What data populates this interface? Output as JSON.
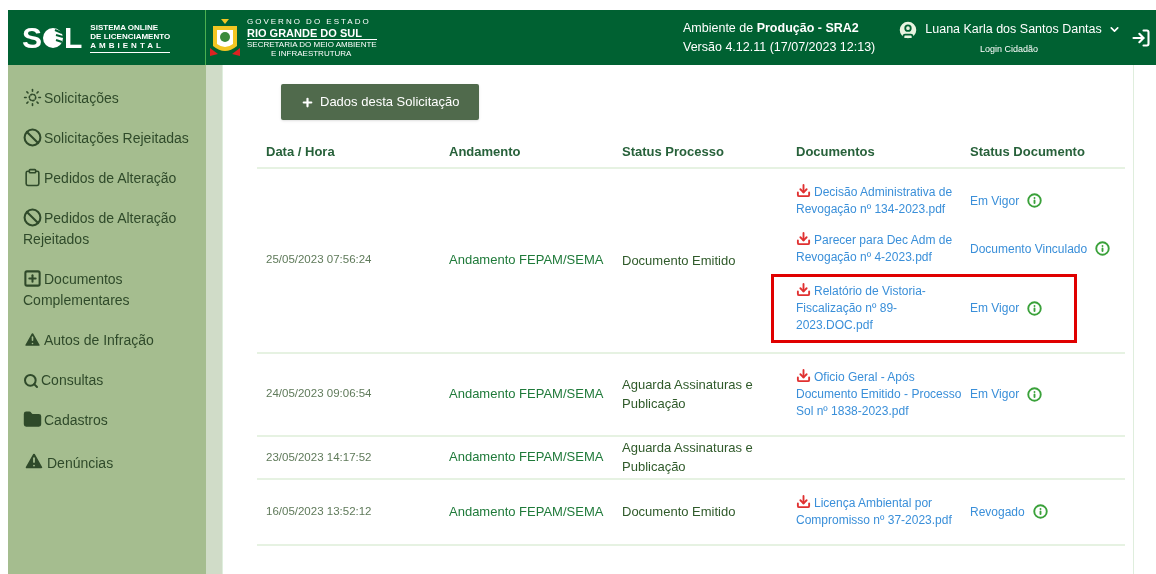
{
  "header": {
    "logo": {
      "letter_left": "S",
      "letter_right": "L",
      "line_1": "SISTEMA  ONLINE",
      "line_2": "DE LICENCIAMENTO",
      "line_3": "AMBIENTAL"
    },
    "government": {
      "line_1": "GOVERNO DO ESTADO",
      "line_2": "RIO GRANDE DO SUL",
      "line_3": "SECRETARIA DO MEIO AMBIENTE",
      "line_4": "E INFRAESTRUTURA"
    },
    "environment": "Ambiente de **Produção - SRA2**",
    "version": "Versão 4.12.11 (17/07/2023 12:13)",
    "user": {
      "name": "Luana Karla dos Santos Dantas",
      "login_type": "Login Cidadão"
    }
  },
  "sidebar": {
    "items": [
      {
        "label": "Solicitações",
        "kind": "sun"
      },
      {
        "label": "Solicitações Rejeitadas",
        "kind": "ban"
      },
      {
        "label": "Pedidos de Alteração",
        "kind": "clipboard"
      },
      {
        "label": "Pedidos de Alteração Rejeitados",
        "kind": "ban"
      },
      {
        "label": "Documentos Complementares",
        "kind": "plus"
      },
      {
        "label": "Autos de Infração",
        "kind": "warning"
      },
      {
        "label": "Consultas",
        "kind": "search"
      },
      {
        "label": "Cadastros",
        "kind": "folder"
      },
      {
        "label": "Denúncias",
        "kind": "warning-large"
      }
    ]
  },
  "main": {
    "button": "Dados desta Solicitação",
    "table": {
      "columns": [
        "Data / Hora",
        "Andamento",
        "Status Processo",
        "Documentos",
        "Status Documento"
      ],
      "rows": [
        {
          "date": "25/05/2023 07:56:24",
          "progress": "Andamento FEPAM/SEMA",
          "status": "Documento Emitido",
          "documents": [
            {
              "name": "Decisão Administrativa de Revogação nº 134-2023.pdf",
              "status": "Em Vigor",
              "highlighted": false
            },
            {
              "name": "Parecer para Dec Adm de Revogação nº 4-2023.pdf",
              "status": "Documento Vinculado",
              "highlighted": false
            },
            {
              "name": "Relatório de Vistoria-Fiscalização nº 89-2023.DOC.pdf",
              "status": "Em Vigor",
              "highlighted": true
            }
          ]
        },
        {
          "date": "24/05/2023 09:06:54",
          "progress": "Andamento FEPAM/SEMA",
          "status": "Aguarda Assinaturas e Publicação",
          "documents": [
            {
              "name": "Oficio Geral - Após Documento Emitido - Processo Sol nº 1838-2023.pdf",
              "status": "Em Vigor",
              "highlighted": false
            }
          ]
        },
        {
          "date": "23/05/2023 14:17:52",
          "progress": "Andamento FEPAM/SEMA",
          "status": "Aguarda Assinaturas e Publicação"
        },
        {
          "date": "16/05/2023 13:52:12",
          "progress": "Andamento FEPAM/SEMA",
          "status": "Documento Emitido",
          "documents": [
            {
              "name": "Licença Ambiental por Compromisso nº 37-2023.pdf",
              "status": "Revogado",
              "highlighted": false
            }
          ]
        }
      ]
    }
  }
}
